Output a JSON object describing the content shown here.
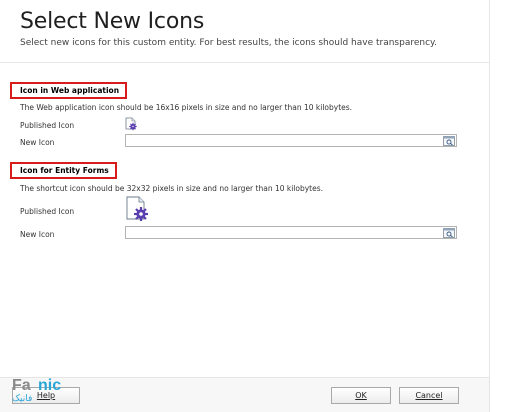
{
  "dialog": {
    "title": "Select New Icons",
    "subtitle": "Select new icons for this custom entity. For best results, the icons should have transparency."
  },
  "web_section": {
    "heading": "Icon in Web application",
    "description": "The Web application icon should be 16x16 pixels in size and no larger than 10 kilobytes.",
    "published_label": "Published Icon",
    "new_icon_label": "New Icon",
    "new_icon_value": ""
  },
  "form_section": {
    "heading": "Icon for Entity Forms",
    "description": "The shortcut icon should be 32x32 pixels in size and no larger than 10 kilobytes.",
    "published_label": "Published Icon",
    "new_icon_label": "New Icon",
    "new_icon_value": ""
  },
  "footer": {
    "help_label": "Help",
    "ok_label": "OK",
    "cancel_label": "Cancel"
  },
  "watermark": {
    "brand_gray": "Fa",
    "brand_blue": "nic",
    "brand_sub": "فانیک"
  },
  "icons": {
    "small_published": "document-gear-icon",
    "large_published": "document-gear-icon",
    "browse": "browse-icon"
  },
  "colors": {
    "highlight_border": "#d81b1b",
    "gear": "#5a3fb0",
    "watermark_blue": "#2aa6d6"
  }
}
